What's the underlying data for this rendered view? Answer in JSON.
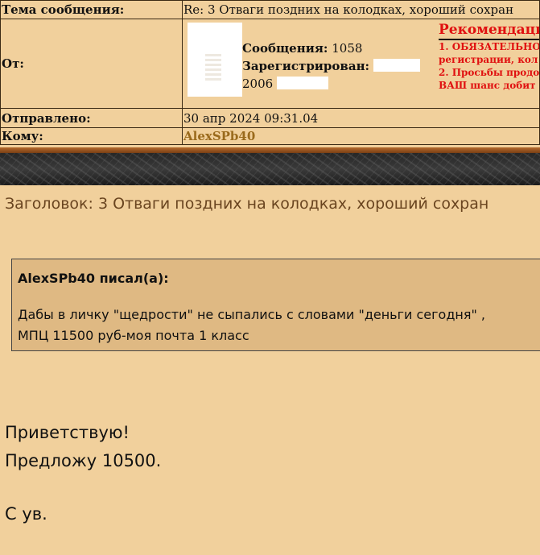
{
  "header": {
    "subject_label": "Тема сообщения:",
    "subject_value": "Re: 3 Отваги поздних на колодках, хороший сохран",
    "from_label": "От:",
    "messages_label": "Сообщения:",
    "messages_count": "1058",
    "registered_label": "Зарегистрирован:",
    "registered_year": "2006",
    "sent_label": "Отправлено:",
    "sent_value": "30 апр 2024 09:31.04",
    "to_label": "Кому:",
    "to_value": "AlexSPb40"
  },
  "recommendations": {
    "title": "Рекомендаци",
    "line1": "1. ОБЯЗАТЕЛЬНО",
    "line2": "регистрации, кол",
    "line3": "2. Просьбы продо",
    "line4": "ВАШ шанс добит"
  },
  "post": {
    "title": "Заголовок: 3 Отваги поздних на колодках, хороший сохран",
    "quote_author": "AlexSPb40 писал(а):",
    "quote_line1": "Дабы в личку \"щедрости\" не сыпались с словами \"деньги сегодня\" ,",
    "quote_line2": "МПЦ 11500 руб-моя почта 1 класс",
    "body_line1": "Приветствую!",
    "body_line2": "Предложу 10500.",
    "body_line3": "С ув."
  },
  "colors": {
    "background": "#f1d09c",
    "quote_background": "#dfb983",
    "recommendation_red": "#e01010",
    "link_gold": "#9a6a1c"
  }
}
